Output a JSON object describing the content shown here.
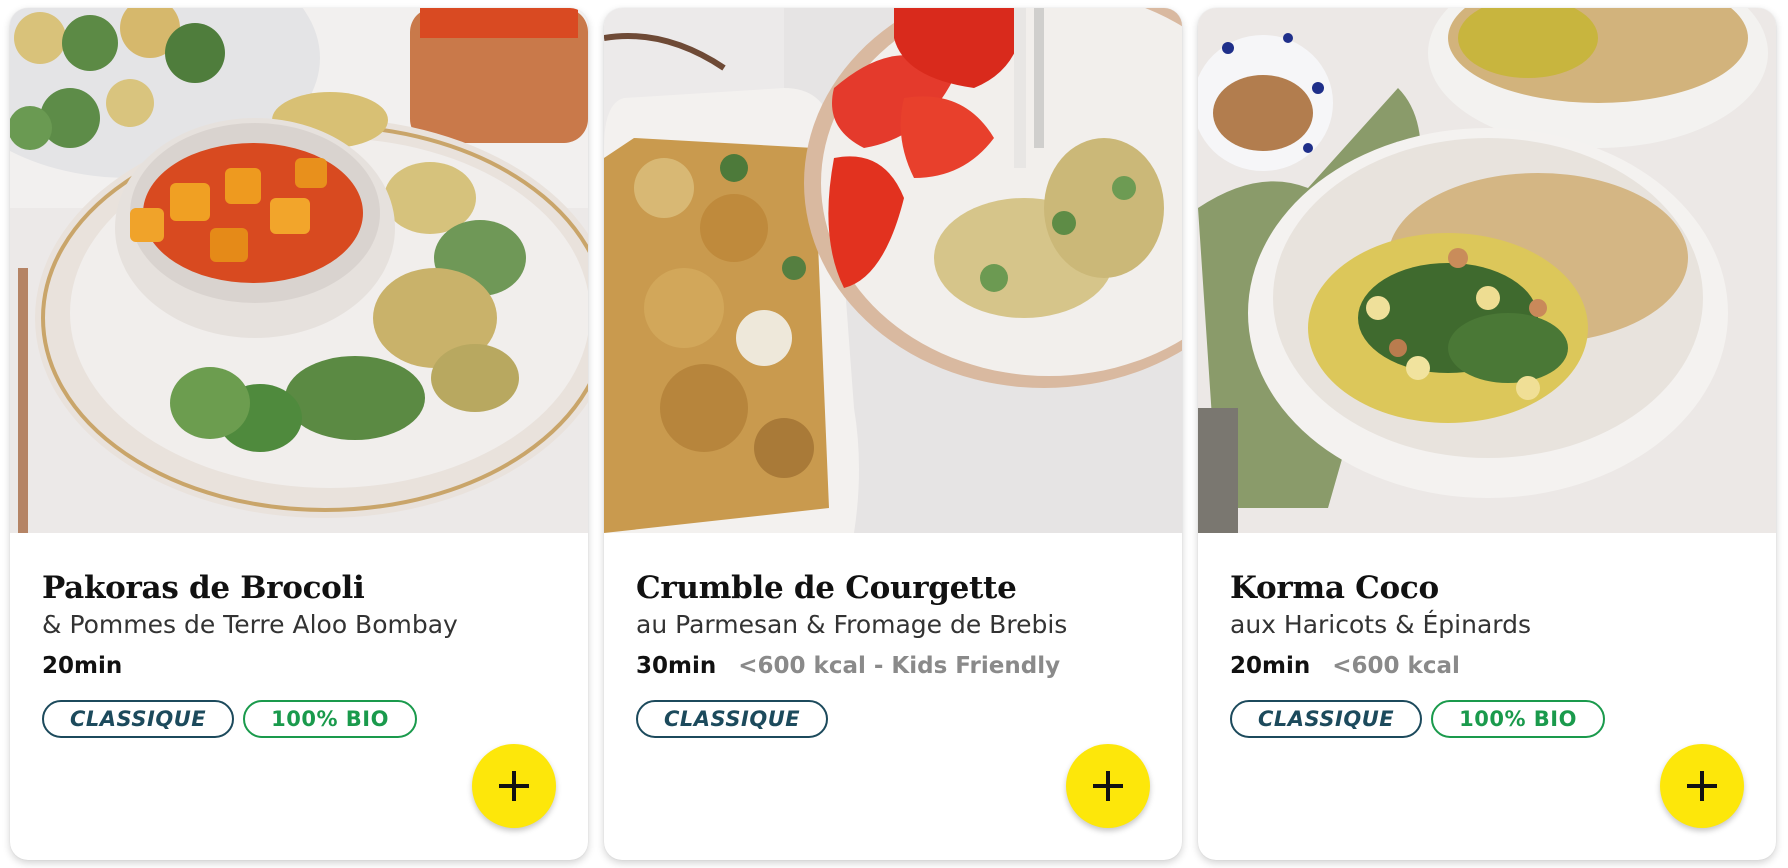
{
  "recipes": [
    {
      "title": "Pakoras de Brocoli",
      "subtitle": "& Pommes de Terre Aloo Bombay",
      "time": "20min",
      "extra": "",
      "tags": [
        "CLASSIQUE",
        "100% BIO"
      ]
    },
    {
      "title": "Crumble de Courgette",
      "subtitle": "au Parmesan & Fromage de Brebis",
      "time": "30min",
      "extra": "<600 kcal - Kids Friendly",
      "tags": [
        "CLASSIQUE"
      ]
    },
    {
      "title": "Korma Coco",
      "subtitle": "aux Haricots & Épinards",
      "time": "20min",
      "extra": "<600 kcal",
      "tags": [
        "CLASSIQUE",
        "100% BIO"
      ]
    }
  ],
  "icons": {
    "add": "plus-icon"
  },
  "colors": {
    "add_button": "#fde70a",
    "tag_classique": "#1c4a5c",
    "tag_bio": "#1a9a4c",
    "meta_extra": "#8a8a8a"
  }
}
